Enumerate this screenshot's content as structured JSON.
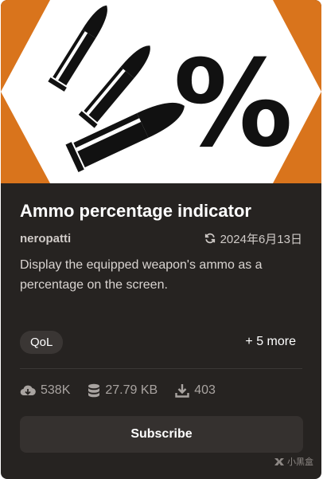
{
  "mod": {
    "title": "Ammo percentage indicator",
    "author": "neropatti",
    "updated_date": "2024年6月13日",
    "description": "Display the equipped weapon's ammo as a percentage on the screen.",
    "tags": [
      "QoL"
    ],
    "more_tags": "+ 5 more",
    "stats": {
      "downloads": "538K",
      "size": "27.79 KB",
      "endorsements": "403"
    },
    "subscribe_label": "Subscribe"
  },
  "thumbnail": {
    "symbol": "%",
    "background_color": "#d9741c",
    "shape_color": "#ffffff",
    "glyph_color": "#111111"
  },
  "watermark": "小黑盒",
  "icons": {
    "updated": "refresh-icon",
    "downloads": "cloud-download-icon",
    "size": "database-icon",
    "endorsements": "download-icon"
  }
}
